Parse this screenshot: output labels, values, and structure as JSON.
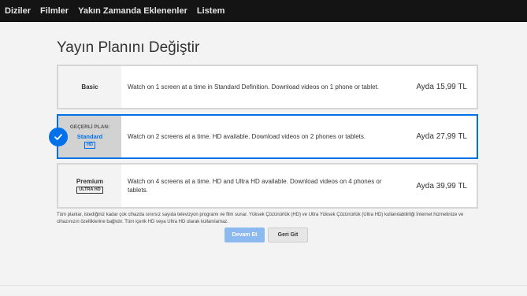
{
  "nav": {
    "items": [
      "Diziler",
      "Filmler",
      "Yakın Zamanda Eklenenler",
      "Listem"
    ]
  },
  "page": {
    "title": "Yayın Planını Değiştir"
  },
  "plans": [
    {
      "name": "Basic",
      "description": "Watch on 1 screen at a time in Standard Definition. Download videos on 1 phone or tablet.",
      "price": "Ayda 15,99 TL"
    },
    {
      "current_label": "GEÇERLİ PLAN:",
      "name": "Standard",
      "badge": "HD",
      "description": "Watch on 2 screens at a time. HD available. Download videos on 2 phones or tablets.",
      "price": "Ayda 27,99 TL"
    },
    {
      "name": "Premium",
      "badge": "ULTRA HD",
      "description": "Watch on 4 screens at a time. HD and Ultra HD available. Download videos on 4 phones or tablets.",
      "price": "Ayda 39,99 TL"
    }
  ],
  "footnote": "Tüm planlar, istediğiniz kadar çok cihazda sınırsız sayıda televizyon programı ve film sunar. Yüksek Çözünürlük (HD) ve Ultra Yüksek Çözünürlük (Ultra HD) kullanılabilirliği İnternet hizmetinize ve cihazınızın özelliklerine bağlıdır. Tüm içerik HD veya Ultra HD olarak kullanılamaz.",
  "buttons": {
    "continue": "Devam Et",
    "back": "Geri Git"
  },
  "colors": {
    "accent": "#0071eb",
    "nav_bg": "#141414"
  }
}
